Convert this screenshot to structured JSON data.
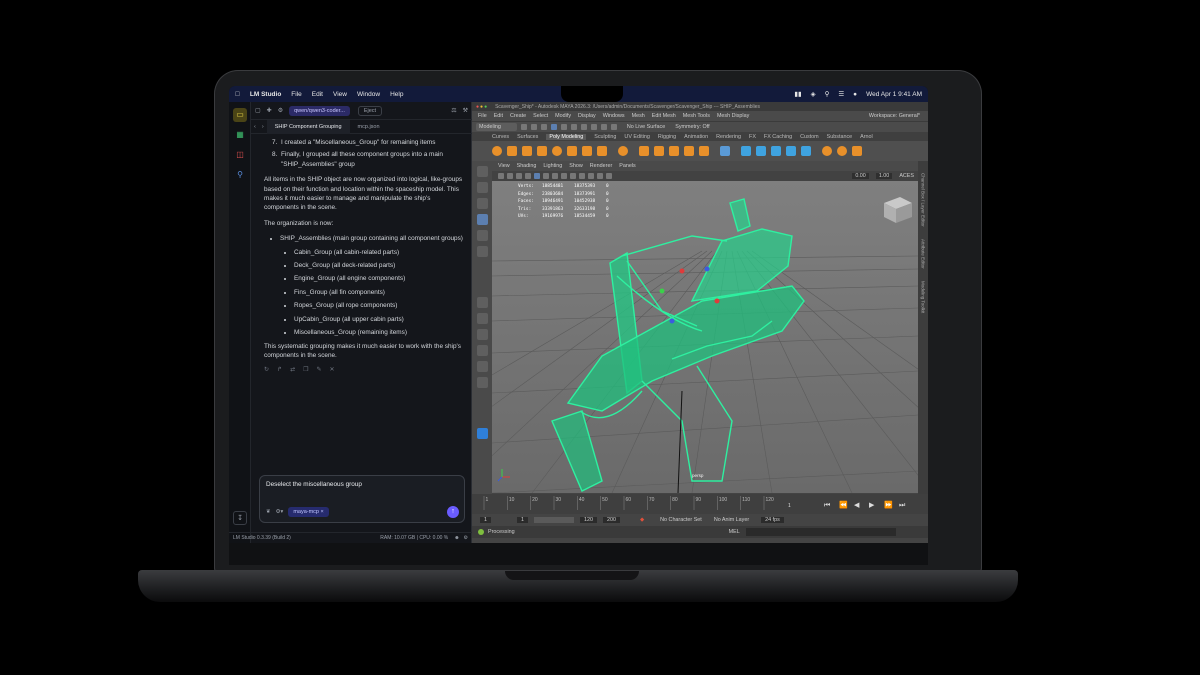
{
  "menubar": {
    "app": "LM Studio",
    "items": [
      "File",
      "Edit",
      "View",
      "Window",
      "Help"
    ],
    "datetime": "Wed Apr 1  9:41 AM"
  },
  "lms": {
    "model": "qwen/qwen3-coder...",
    "eject": "Eject",
    "tabs": [
      "SHIP Component Grouping",
      "mcp.json"
    ],
    "list_item_7": "I created a \"Miscellaneous_Group\" for remaining items",
    "list_item_8": "Finally, I grouped all these component groups into a main \"SHIP_Assemblies\" group",
    "para1": "All items in the SHIP object are now organized into logical, like-groups based on their function and location within the spaceship model. This makes it much easier to manage and manipulate the ship's components in the scene.",
    "para2": "The organization is now:",
    "main_group": "SHIP_Assemblies (main group containing all component groups)",
    "groups": [
      "Cabin_Group (all cabin-related parts)",
      "Deck_Group (all deck-related parts)",
      "Engine_Group (all engine components)",
      "Fins_Group (all fin components)",
      "Ropes_Group (all rope components)",
      "UpCabin_Group (all upper cabin parts)",
      "Miscellaneous_Group (remaining items)"
    ],
    "para3": "This systematic grouping makes it much easier to work with the ship's components in the scene.",
    "composer_text": "Deselect the miscellaneous group",
    "chip": "maya-mcp",
    "status_left": "LM Studio 0.3.39 (Build 2)",
    "status_right": "RAM: 10.07 GB  |  CPU: 0.00 %"
  },
  "maya": {
    "title": "Scavenger_Ship* - Autodesk MAYA 2026.3: /Users/admin/Documents/Scavenger/Scavenger_Ship  ---  SHIP_Assemblies",
    "menus": [
      "File",
      "Edit",
      "Create",
      "Select",
      "Modify",
      "Display",
      "Windows",
      "Mesh",
      "Edit Mesh",
      "Mesh Tools",
      "Mesh Display"
    ],
    "workspace": "Workspace: General*",
    "mode": "Modeling",
    "no_live": "No Live Surface",
    "symmetry": "Symmetry: Off",
    "shelf_tabs": [
      "Curves",
      "Surfaces",
      "Poly Modeling",
      "Sculpting",
      "UV Editing",
      "Rigging",
      "Animation",
      "Rendering",
      "FX",
      "FX Caching",
      "Custom",
      "Substance",
      "Arnol"
    ],
    "vp_menus": [
      "View",
      "Shading",
      "Lighting",
      "Show",
      "Renderer",
      "Panels"
    ],
    "vp_fields": [
      "0.00",
      "1.00",
      "ACES"
    ],
    "hud": [
      [
        "Verts:",
        "18854481",
        "18375393",
        "0"
      ],
      [
        "Edges:",
        "23803684",
        "18373991",
        "0"
      ],
      [
        "Faces:",
        "18946491",
        "10452938",
        "0"
      ],
      [
        "Tris:",
        "33391863",
        "32633198",
        "0"
      ],
      [
        "UVs:",
        "19169976",
        "18534459",
        "0"
      ]
    ],
    "camera": "persp",
    "right_labels": [
      "Channel Box / Layer Editor",
      "Attribute Editor",
      "Modeling Toolkit"
    ],
    "timeline_ticks": [
      "1",
      "10",
      "20",
      "30",
      "40",
      "50",
      "60",
      "70",
      "80",
      "90",
      "100",
      "110",
      "120"
    ],
    "current_frame": "1",
    "range": [
      "1",
      "1",
      "120",
      "200"
    ],
    "no_char": "No Character Set",
    "no_anim": "No Anim Layer",
    "fps": "24 fps",
    "processing": "Processing",
    "mel": "MEL",
    "colors": {
      "wire": "#2ef0a0"
    }
  }
}
